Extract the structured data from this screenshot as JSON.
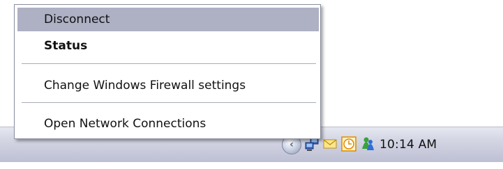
{
  "menu": {
    "items": [
      {
        "label": "Disconnect",
        "highlighted": true,
        "bold": false
      },
      {
        "label": "Status",
        "highlighted": false,
        "bold": true
      },
      {
        "label": "Change Windows Firewall settings",
        "highlighted": false,
        "bold": false
      },
      {
        "label": "Open Network Connections",
        "highlighted": false,
        "bold": false
      }
    ],
    "highlight_color": "#aeb0c4"
  },
  "tray": {
    "clock": "10:14 AM",
    "icons": [
      "show-hidden-icons-chevron",
      "network-icon",
      "mail-icon",
      "clock-icon",
      "messenger-icon"
    ]
  }
}
